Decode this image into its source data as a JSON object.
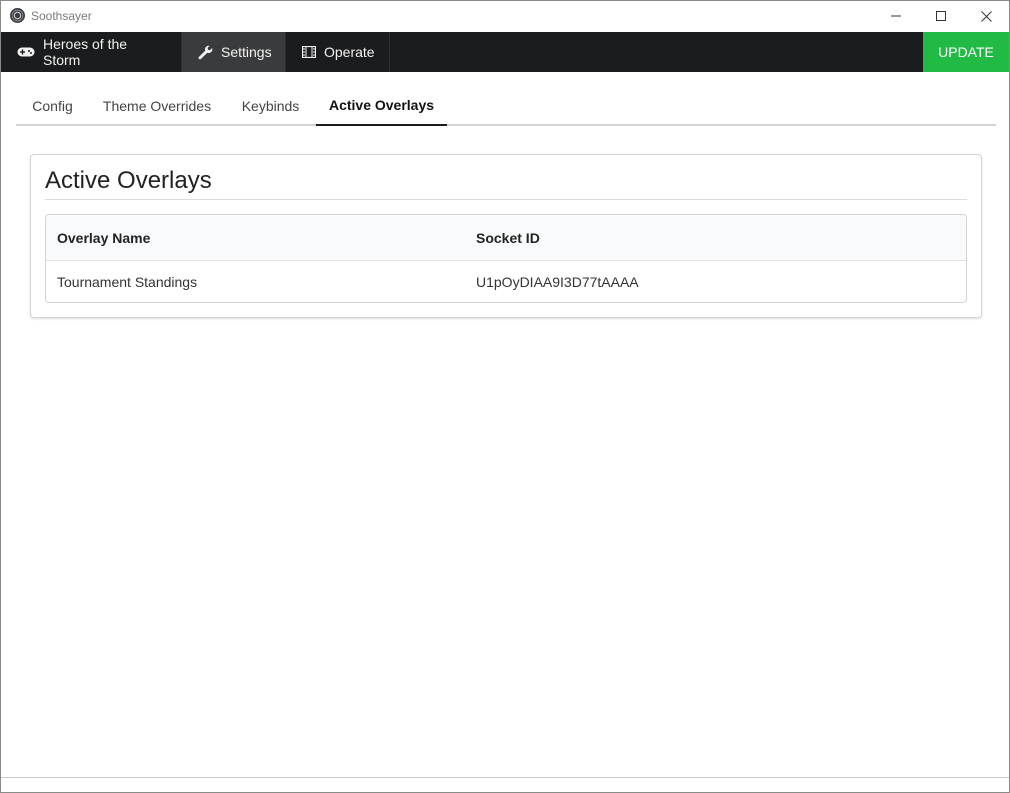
{
  "window": {
    "title": "Soothsayer"
  },
  "topnav": {
    "items": [
      {
        "label": "Heroes of the Storm",
        "icon": "gamepad-icon"
      },
      {
        "label": "Settings",
        "icon": "wrench-icon"
      },
      {
        "label": "Operate",
        "icon": "film-icon"
      }
    ],
    "update_label": "UPDATE",
    "colors": {
      "bar": "#1b1c1d",
      "active": "#3a3b3c",
      "update": "#21ba45"
    }
  },
  "tabs": [
    {
      "label": "Config"
    },
    {
      "label": "Theme Overrides"
    },
    {
      "label": "Keybinds"
    },
    {
      "label": "Active Overlays",
      "active": true
    }
  ],
  "panel": {
    "title": "Active Overlays",
    "table": {
      "columns": [
        "Overlay Name",
        "Socket ID"
      ],
      "rows": [
        {
          "name": "Tournament Standings",
          "socket_id": "U1pOyDIAA9I3D77tAAAA"
        }
      ]
    }
  }
}
